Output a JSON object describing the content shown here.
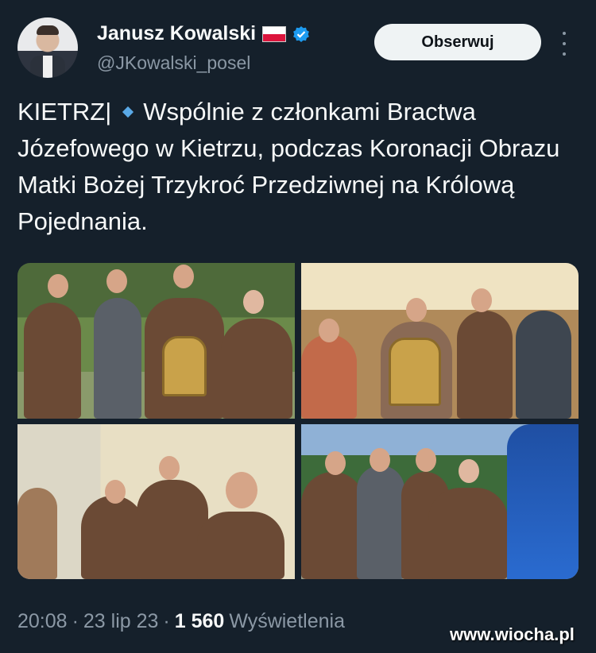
{
  "author": {
    "name": "Janusz Kowalski",
    "handle": "@JKowalski_posel",
    "flag_icon": "poland-flag-icon",
    "verified_icon": "verified-badge-icon"
  },
  "actions": {
    "follow_label": "Obserwuj",
    "more_icon": "more-vertical-icon"
  },
  "tweet": {
    "prefix": "KIETRZ|",
    "body": "Wspólnie z członkami Bractwa Józefowego w Kietrzu, podczas Koronacji Obrazu Matki Bożej Trzykroć Przedziwnej na Królową Pojednania."
  },
  "meta": {
    "time": "20:08",
    "date": "23 lip 23",
    "views_count": "1 560",
    "views_label": "Wyświetlenia"
  },
  "watermark": "www.wiocha.pl",
  "colors": {
    "background": "#15202b",
    "text": "#f7f9f9",
    "secondary": "#8b98a5",
    "verified": "#1d9bf0"
  }
}
